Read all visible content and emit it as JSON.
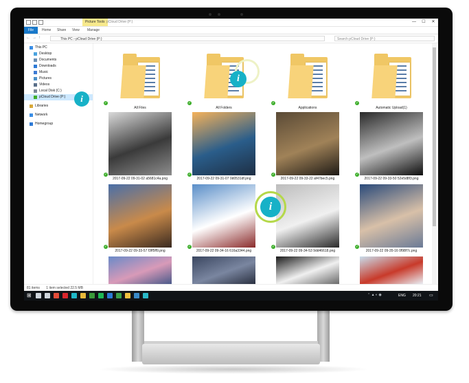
{
  "window": {
    "context_tab": "Picture Tools",
    "title": "pCloud Drive (P:)",
    "minimize": "—",
    "maximize": "☐",
    "close": "✕"
  },
  "ribbon": {
    "tabs": [
      "File",
      "Home",
      "Share",
      "View",
      "Manage"
    ]
  },
  "address": {
    "path": "This PC  ›  pCloud Drive (P:)",
    "search_placeholder": "Search pCloud Drive (P:)"
  },
  "sidebar": {
    "items": [
      {
        "label": "This PC",
        "level": 0,
        "icon": "pc-icon",
        "color": "#3a8ee6"
      },
      {
        "label": "Desktop",
        "level": 1,
        "icon": "desktop-icon",
        "color": "#4aa3df"
      },
      {
        "label": "Documents",
        "level": 1,
        "icon": "documents-icon",
        "color": "#6c8fb3"
      },
      {
        "label": "Downloads",
        "level": 1,
        "icon": "downloads-icon",
        "color": "#2d7ad6"
      },
      {
        "label": "Music",
        "level": 1,
        "icon": "music-icon",
        "color": "#3d7bd4"
      },
      {
        "label": "Pictures",
        "level": 1,
        "icon": "pictures-icon",
        "color": "#4a90c8"
      },
      {
        "label": "Videos",
        "level": 1,
        "icon": "videos-icon",
        "color": "#5a6f8a"
      },
      {
        "label": "Local Disk (C:)",
        "level": 1,
        "icon": "disk-icon",
        "color": "#7a8899"
      },
      {
        "label": "pCloud Drive (P:)",
        "level": 1,
        "icon": "pcloud-drive-icon",
        "color": "#3dae2b",
        "selected": true
      },
      {
        "label": "Libraries",
        "level": 0,
        "icon": "libraries-icon",
        "color": "#d8a93a"
      },
      {
        "label": "Network",
        "level": 0,
        "icon": "network-icon",
        "color": "#3a8ee6"
      },
      {
        "label": "Homegroup",
        "level": 0,
        "icon": "homegroup-icon",
        "color": "#2d7ad6"
      }
    ]
  },
  "folders": [
    {
      "label": "All Files"
    },
    {
      "label": "All Folders"
    },
    {
      "label": "Applications"
    },
    {
      "label": "Automatic Upload(1)"
    }
  ],
  "photos": [
    {
      "label": "2017-09-22 09-31-02 a5681c4a.png",
      "colors": [
        "#d9d9d9",
        "#3a3a3a",
        "#8d8d8d"
      ]
    },
    {
      "label": "2017-09-22 09-31-07 0d0531df.png",
      "colors": [
        "#f5b25a",
        "#2a5d8a",
        "#1e2f44"
      ]
    },
    {
      "label": "2017-09-22 09-33-22 af47bec5.png",
      "colors": [
        "#5a4a36",
        "#a08258",
        "#1e1a16"
      ]
    },
    {
      "label": "2017-09-22 09-33-50 52e5d8f3.png",
      "colors": [
        "#2a2a2a",
        "#bfbfbf",
        "#0e0e0e"
      ]
    },
    {
      "label": "2017-09-22 09-33-57 f3ff5ff9.png",
      "colors": [
        "#4a6fa8",
        "#c98a4a",
        "#3a2a20"
      ]
    },
    {
      "label": "2017-09-22 09-34-16 616a3344.png",
      "colors": [
        "#5a8ec8",
        "#ffffff",
        "#8a2a2a"
      ]
    },
    {
      "label": "2017-09-22 09-34-53 9dd46618.png",
      "colors": [
        "#bdbdbd",
        "#f0f0f0",
        "#2a2a2a"
      ]
    },
    {
      "label": "2017-09-22 09-35-16 0f98f7c.png",
      "colors": [
        "#2a4a7a",
        "#d8c0a8",
        "#6a7a96"
      ]
    },
    {
      "label": "",
      "colors": [
        "#6a8ac8",
        "#d89ab8",
        "#4a5a8a"
      ]
    },
    {
      "label": "",
      "colors": [
        "#3a4660",
        "#7a86a0",
        "#2a3040"
      ]
    },
    {
      "label": "",
      "colors": [
        "#1a1a1a",
        "#f0f0f0",
        "#6a6a6a"
      ]
    },
    {
      "label": "",
      "colors": [
        "#c8dcea",
        "#c83a2a",
        "#e8eef4"
      ]
    }
  ],
  "status": {
    "count": "81 items",
    "selection": "1 item selected  22.5 MB"
  },
  "taskbar": {
    "icons": [
      {
        "name": "windows-start-icon",
        "color": "#ffffff"
      },
      {
        "name": "search-icon",
        "color": "#cfd6dd"
      },
      {
        "name": "task-view-icon",
        "color": "#cfd6dd"
      },
      {
        "name": "chrome-icon",
        "color": "#e34d3a"
      },
      {
        "name": "opera-icon",
        "color": "#d8262d"
      },
      {
        "name": "pcloud-icon",
        "color": "#20b8c8"
      },
      {
        "name": "folder-icon",
        "color": "#e8b93a"
      },
      {
        "name": "app-icon",
        "color": "#3a9a3a"
      },
      {
        "name": "spotify-icon",
        "color": "#1db954"
      },
      {
        "name": "app-icon-2",
        "color": "#2a7ad6"
      },
      {
        "name": "app-icon-3",
        "color": "#3aa04a"
      },
      {
        "name": "app-icon-4",
        "color": "#f0c040"
      },
      {
        "name": "app-icon-5",
        "color": "#3a8ac8"
      },
      {
        "name": "app-icon-6",
        "color": "#2ab8c8"
      }
    ],
    "language": "ENG",
    "time": "20:21"
  },
  "callouts": [
    {
      "glyph": "i"
    },
    {
      "glyph": "i"
    },
    {
      "glyph": "i"
    }
  ]
}
